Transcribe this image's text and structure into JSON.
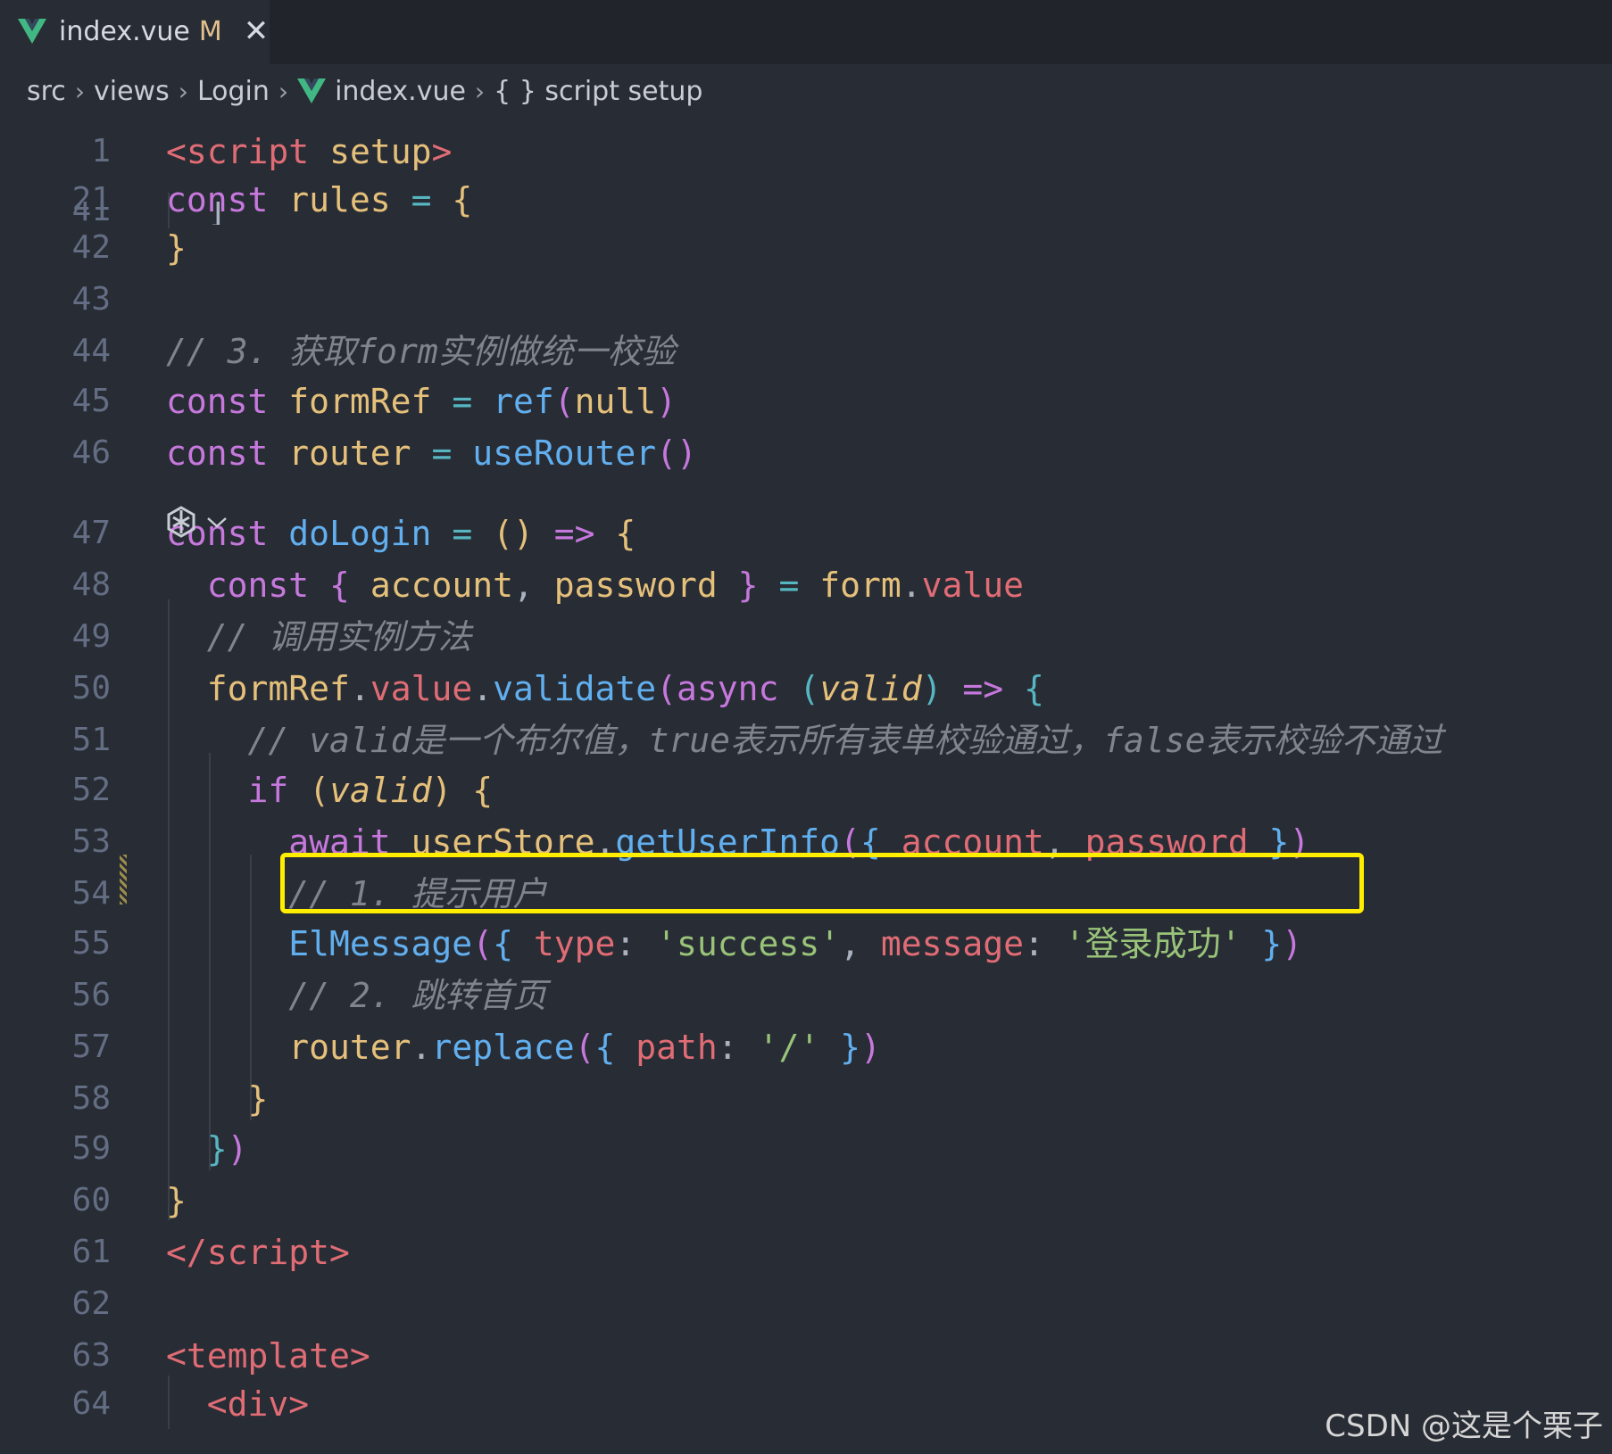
{
  "tab": {
    "filename": "index.vue",
    "status": "M",
    "close": "✕"
  },
  "breadcrumb": [
    "src",
    "views",
    "Login",
    "index.vue",
    "{ } script setup"
  ],
  "lines": [
    {
      "n": "1",
      "tokens": [
        [
          "tag",
          "<"
        ],
        [
          "tag",
          "script"
        ],
        [
          "punc",
          " "
        ],
        [
          "var",
          "setup"
        ],
        [
          "tag",
          ">"
        ]
      ]
    },
    {
      "n": "21",
      "tokens": [
        [
          "kw",
          "const"
        ],
        [
          "punc",
          " "
        ],
        [
          "var",
          "rules"
        ],
        [
          "punc",
          " "
        ],
        [
          "op",
          "="
        ],
        [
          "punc",
          " "
        ],
        [
          "p1",
          "{"
        ]
      ]
    },
    {
      "n": "41",
      "tokens": [
        [
          "punc",
          "  ]"
        ]
      ]
    },
    {
      "n": "42",
      "tokens": [
        [
          "p1",
          "}"
        ]
      ]
    },
    {
      "n": "43",
      "tokens": []
    },
    {
      "n": "44",
      "tokens": [
        [
          "cm",
          "// 3. 获取form实例做统一校验"
        ]
      ]
    },
    {
      "n": "45",
      "tokens": [
        [
          "kw",
          "const"
        ],
        [
          "punc",
          " "
        ],
        [
          "var",
          "formRef"
        ],
        [
          "punc",
          " "
        ],
        [
          "op",
          "="
        ],
        [
          "punc",
          " "
        ],
        [
          "fn",
          "ref"
        ],
        [
          "p2",
          "("
        ],
        [
          "var",
          "null"
        ],
        [
          "p2",
          ")"
        ]
      ]
    },
    {
      "n": "46",
      "tokens": [
        [
          "kw",
          "const"
        ],
        [
          "punc",
          " "
        ],
        [
          "var",
          "router"
        ],
        [
          "punc",
          " "
        ],
        [
          "op",
          "="
        ],
        [
          "punc",
          " "
        ],
        [
          "fn",
          "useRouter"
        ],
        [
          "p2",
          "()"
        ]
      ]
    },
    {
      "n": "47",
      "tokens": [
        [
          "kw",
          "const"
        ],
        [
          "punc",
          " "
        ],
        [
          "fn",
          "doLogin"
        ],
        [
          "punc",
          " "
        ],
        [
          "op",
          "="
        ],
        [
          "punc",
          " "
        ],
        [
          "p1",
          "()"
        ],
        [
          "punc",
          " "
        ],
        [
          "kw",
          "=>"
        ],
        [
          "punc",
          " "
        ],
        [
          "p1",
          "{"
        ]
      ]
    },
    {
      "n": "48",
      "tokens": [
        [
          "punc",
          "  "
        ],
        [
          "kw",
          "const"
        ],
        [
          "punc",
          " "
        ],
        [
          "p2",
          "{"
        ],
        [
          "punc",
          " "
        ],
        [
          "var",
          "account"
        ],
        [
          "punc",
          ", "
        ],
        [
          "var",
          "password"
        ],
        [
          "punc",
          " "
        ],
        [
          "p2",
          "}"
        ],
        [
          "punc",
          " "
        ],
        [
          "op",
          "="
        ],
        [
          "punc",
          " "
        ],
        [
          "var",
          "form"
        ],
        [
          "punc",
          "."
        ],
        [
          "prop",
          "value"
        ]
      ]
    },
    {
      "n": "49",
      "tokens": [
        [
          "punc",
          "  "
        ],
        [
          "cm",
          "// 调用实例方法"
        ]
      ]
    },
    {
      "n": "50",
      "tokens": [
        [
          "punc",
          "  "
        ],
        [
          "var",
          "formRef"
        ],
        [
          "punc",
          "."
        ],
        [
          "prop",
          "value"
        ],
        [
          "punc",
          "."
        ],
        [
          "fn",
          "validate"
        ],
        [
          "p2",
          "("
        ],
        [
          "kw",
          "async"
        ],
        [
          "punc",
          " "
        ],
        [
          "p4",
          "("
        ],
        [
          "pm",
          "valid"
        ],
        [
          "p4",
          ")"
        ],
        [
          "punc",
          " "
        ],
        [
          "kw",
          "=>"
        ],
        [
          "punc",
          " "
        ],
        [
          "p4",
          "{"
        ]
      ]
    },
    {
      "n": "51",
      "tokens": [
        [
          "punc",
          "    "
        ],
        [
          "cm",
          "// valid是一个布尔值，true表示所有表单校验通过，false表示校验不通过"
        ]
      ]
    },
    {
      "n": "52",
      "tokens": [
        [
          "punc",
          "    "
        ],
        [
          "kw",
          "if"
        ],
        [
          "punc",
          " "
        ],
        [
          "p1",
          "("
        ],
        [
          "pm",
          "valid"
        ],
        [
          "p1",
          ")"
        ],
        [
          "punc",
          " "
        ],
        [
          "p1",
          "{"
        ]
      ]
    },
    {
      "n": "53",
      "tokens": [
        [
          "punc",
          "      "
        ],
        [
          "kw",
          "await"
        ],
        [
          "punc",
          " "
        ],
        [
          "var",
          "userStore"
        ],
        [
          "punc",
          "."
        ],
        [
          "fn",
          "getUserInfo"
        ],
        [
          "p2",
          "("
        ],
        [
          "p3",
          "{"
        ],
        [
          "punc",
          " "
        ],
        [
          "prop",
          "account"
        ],
        [
          "punc",
          ", "
        ],
        [
          "prop",
          "password"
        ],
        [
          "punc",
          " "
        ],
        [
          "p3",
          "}"
        ],
        [
          "p2",
          ")"
        ]
      ]
    },
    {
      "n": "54",
      "tokens": [
        [
          "punc",
          "      "
        ],
        [
          "cm",
          "// 1. 提示用户"
        ]
      ]
    },
    {
      "n": "55",
      "tokens": [
        [
          "punc",
          "      "
        ],
        [
          "fn",
          "ElMessage"
        ],
        [
          "p2",
          "("
        ],
        [
          "p3",
          "{"
        ],
        [
          "punc",
          " "
        ],
        [
          "prop",
          "type"
        ],
        [
          "punc",
          ": "
        ],
        [
          "str",
          "'success'"
        ],
        [
          "punc",
          ", "
        ],
        [
          "prop",
          "message"
        ],
        [
          "punc",
          ": "
        ],
        [
          "str",
          "'登录成功'"
        ],
        [
          "punc",
          " "
        ],
        [
          "p3",
          "}"
        ],
        [
          "p2",
          ")"
        ]
      ]
    },
    {
      "n": "56",
      "tokens": [
        [
          "punc",
          "      "
        ],
        [
          "cm",
          "// 2. 跳转首页"
        ]
      ]
    },
    {
      "n": "57",
      "tokens": [
        [
          "punc",
          "      "
        ],
        [
          "var",
          "router"
        ],
        [
          "punc",
          "."
        ],
        [
          "fn",
          "replace"
        ],
        [
          "p2",
          "("
        ],
        [
          "p3",
          "{"
        ],
        [
          "punc",
          " "
        ],
        [
          "prop",
          "path"
        ],
        [
          "punc",
          ": "
        ],
        [
          "str",
          "'/'"
        ],
        [
          "punc",
          " "
        ],
        [
          "p3",
          "}"
        ],
        [
          "p2",
          ")"
        ]
      ]
    },
    {
      "n": "58",
      "tokens": [
        [
          "punc",
          "    "
        ],
        [
          "p1",
          "}"
        ]
      ]
    },
    {
      "n": "59",
      "tokens": [
        [
          "punc",
          "  "
        ],
        [
          "p4",
          "}"
        ],
        [
          "p2",
          ")"
        ]
      ]
    },
    {
      "n": "60",
      "tokens": [
        [
          "p1",
          "}"
        ]
      ]
    },
    {
      "n": "61",
      "tokens": [
        [
          "tag",
          "</"
        ],
        [
          "tag",
          "script"
        ],
        [
          "tag",
          ">"
        ]
      ]
    },
    {
      "n": "62",
      "tokens": []
    },
    {
      "n": "63",
      "tokens": [
        [
          "tag",
          "<"
        ],
        [
          "tag",
          "template"
        ],
        [
          "tag",
          ">"
        ]
      ]
    },
    {
      "n": "64",
      "tokens": [
        [
          "punc",
          "  "
        ],
        [
          "tag",
          "<"
        ],
        [
          "tag",
          "div"
        ],
        [
          "tag",
          ">"
        ]
      ]
    }
  ],
  "watermark": "CSDN @这是个栗子"
}
